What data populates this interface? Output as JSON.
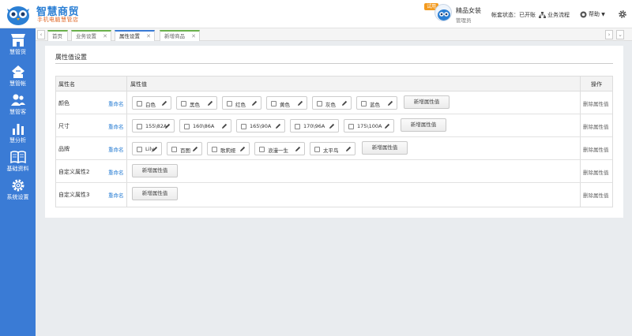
{
  "brand": {
    "title": "智慧商贸",
    "subtitle": "手机电脑慧管店"
  },
  "header": {
    "trial_badge": "试用",
    "store_name": "精品女装",
    "role": "管理员",
    "account_status": "帐套状态：已开账",
    "flow": "业务流程",
    "help": "帮助"
  },
  "sidebar": {
    "items": [
      {
        "label": "慧管货",
        "icon": "store-icon"
      },
      {
        "label": "慧管帐",
        "icon": "ledger-icon"
      },
      {
        "label": "慧管客",
        "icon": "users-icon"
      },
      {
        "label": "慧分析",
        "icon": "bar-chart-icon"
      },
      {
        "label": "基础资料",
        "icon": "book-icon"
      },
      {
        "label": "系统设置",
        "icon": "gear-icon"
      }
    ]
  },
  "tabs": [
    {
      "label": "首页",
      "closable": false
    },
    {
      "label": "业务设置",
      "closable": true
    },
    {
      "label": "属性设置",
      "closable": true,
      "active": true
    },
    {
      "label": "新增商品",
      "closable": true
    }
  ],
  "page": {
    "title": "属性值设置",
    "columns": {
      "name": "属性名",
      "values": "属性值",
      "ops": "操作"
    },
    "rename_label": "重命名",
    "add_label": "新增属性值",
    "delete_label": "删除属性值",
    "rows": [
      {
        "name": "颜色",
        "values": [
          "白色",
          "黑色",
          "红色",
          "黄色",
          "灰色",
          "蓝色"
        ]
      },
      {
        "name": "尺寸",
        "values": [
          "155\\82A",
          "160\\86A",
          "165\\90A",
          "170\\96A",
          "175\\100A"
        ]
      },
      {
        "name": "品牌",
        "values": [
          "Lily",
          "百图",
          "歌莉娅",
          "浪漫一生",
          "太平鸟"
        ]
      },
      {
        "name": "自定义属性2",
        "values": []
      },
      {
        "name": "自定义属性3",
        "values": []
      }
    ]
  },
  "colors": {
    "sidebar": "#3a7bd5",
    "link": "#2b7fd4",
    "accent_green": "#6ab04c",
    "badge": "#f39a1e"
  }
}
